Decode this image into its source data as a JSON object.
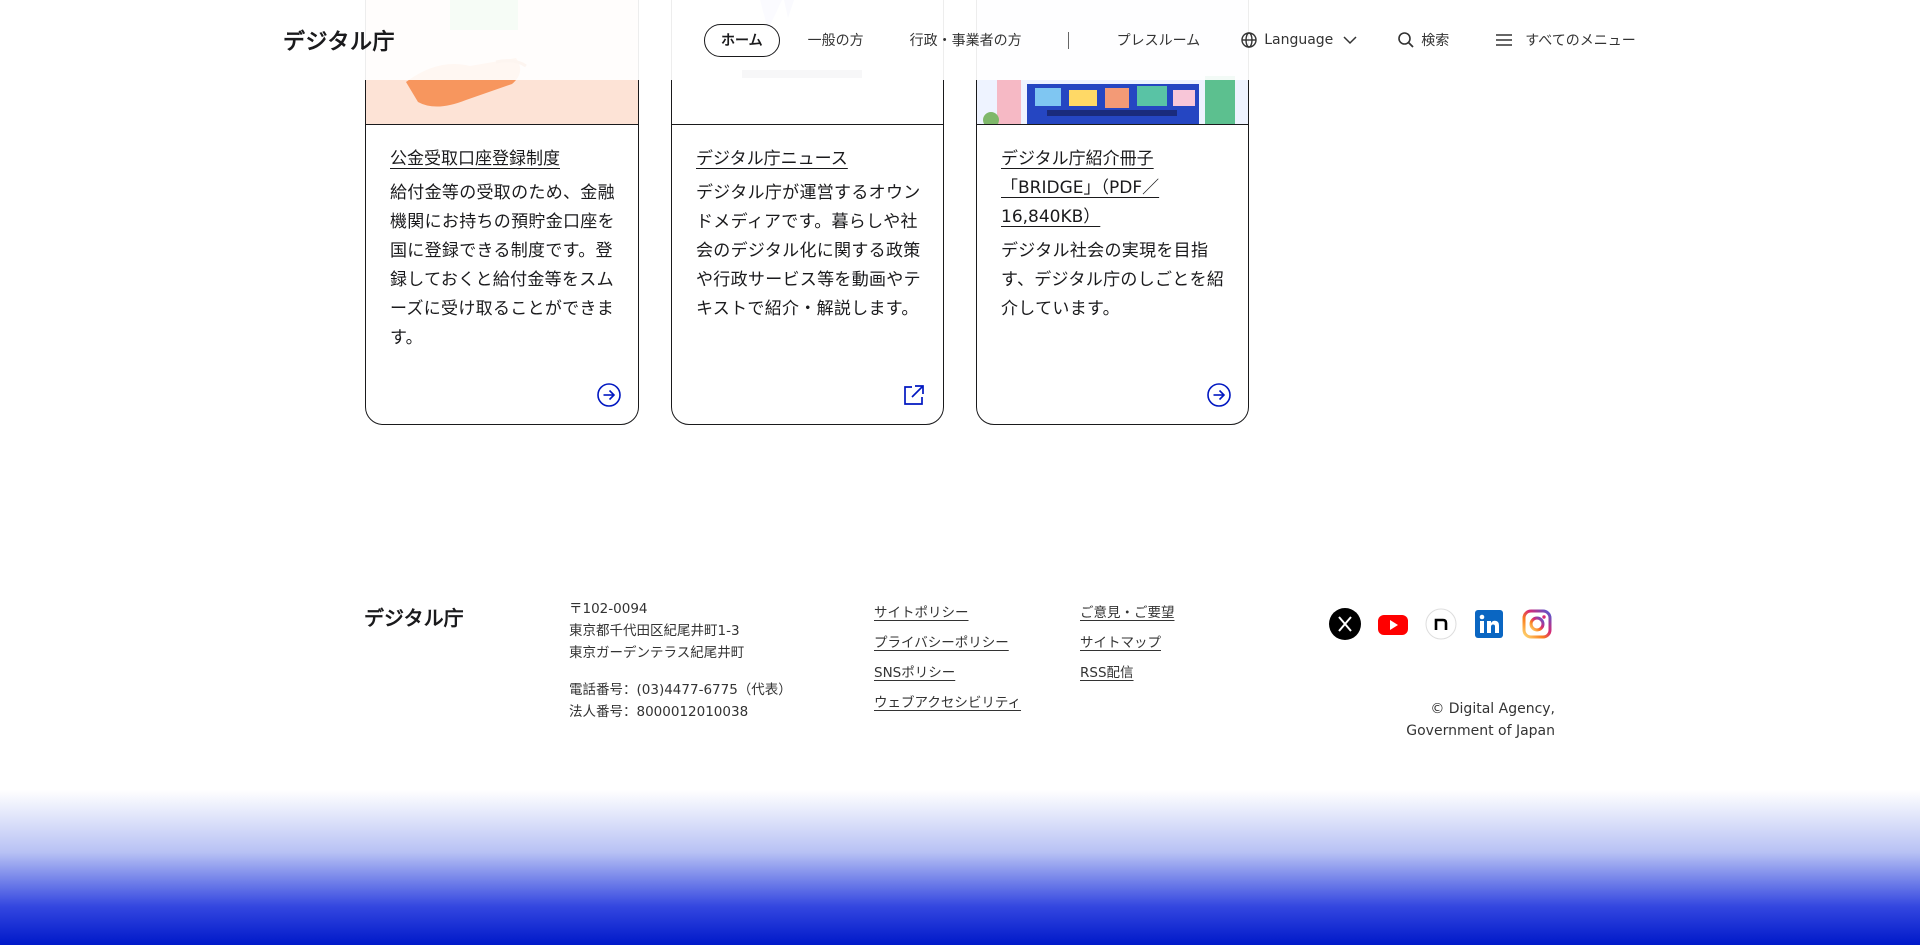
{
  "header": {
    "logo": "デジタル庁",
    "nav": {
      "home": "ホーム",
      "general": "一般の方",
      "business": "行政・事業者の方",
      "press": "プレスルーム",
      "language": "Language",
      "search": "検索",
      "menu": "すべてのメニュー"
    }
  },
  "cards": [
    {
      "title": "公金受取口座登録制度",
      "description": "給付金等の受取のため、金融機関にお持ちの預貯金口座を国に登録できる制度です。登録しておくと給付金等をスムーズに受け取ることができます。",
      "link_icon": "arrow-right-circle-icon"
    },
    {
      "title": "デジタル庁ニュース",
      "description": "デジタル庁が運営するオウンドメディアです。暮らしや社会のデジタル化に関する政策や行政サービス等を動画やテキストで紹介・解説します。",
      "link_icon": "external-link-icon"
    },
    {
      "title_line1": "デジタル庁紹介冊子",
      "title_line2": "「BRIDGE」（PDF／",
      "title_line3": "16,840KB）",
      "description": "デジタル社会の実現を目指す、デジタル庁のしごとを紹介しています。",
      "link_icon": "arrow-right-circle-icon"
    }
  ],
  "footer": {
    "logo": "デジタル庁",
    "address": {
      "postal": "〒102-0094",
      "line1": "東京都千代田区紀尾井町1-3",
      "line2": "東京ガーデンテラス紀尾井町",
      "phone": "電話番号：(03)4477-6775（代表）",
      "corp_number": "法人番号：8000012010038"
    },
    "links_col1": [
      "サイトポリシー",
      "プライバシーポリシー",
      "SNSポリシー",
      "ウェブアクセシビリティ"
    ],
    "links_col2": [
      "ご意見・ご要望",
      "サイトマップ",
      "RSS配信"
    ],
    "social": [
      "x-icon",
      "youtube-icon",
      "note-icon",
      "linkedin-icon",
      "instagram-icon"
    ],
    "copyright_line1": "© Digital Agency,",
    "copyright_line2": "Government of Japan"
  },
  "colors": {
    "text": "#1a1a1c",
    "link_blue": "#0017c1",
    "gradient_bottom": "#0019c9"
  }
}
